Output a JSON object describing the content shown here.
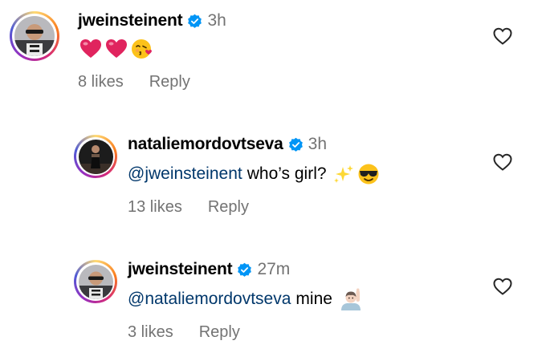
{
  "comments": [
    {
      "username": "jweinsteinent",
      "time": "3h",
      "likes": "8 likes",
      "reply": "Reply",
      "mention": "",
      "text": "",
      "emojis": [
        "red-heart",
        "red-heart",
        "face-blowing-kiss"
      ]
    },
    {
      "username": "nataliemordovtseva",
      "time": "3h",
      "likes": "13 likes",
      "reply": "Reply",
      "mention": "@jweinsteinent",
      "text": "who’s girl?",
      "emojis": [
        "sparkles",
        "smiling-face-with-sunglasses"
      ]
    },
    {
      "username": "jweinsteinent",
      "time": "27m",
      "likes": "3 likes",
      "reply": "Reply",
      "mention": "@nataliemordovtseva",
      "text": "mine",
      "emojis": [
        "person-raising-hand"
      ]
    }
  ],
  "colors": {
    "mention": "#00376b",
    "secondary_text": "#737373",
    "verified_badge": "#0095f6",
    "heart_red": "#e0245e"
  }
}
